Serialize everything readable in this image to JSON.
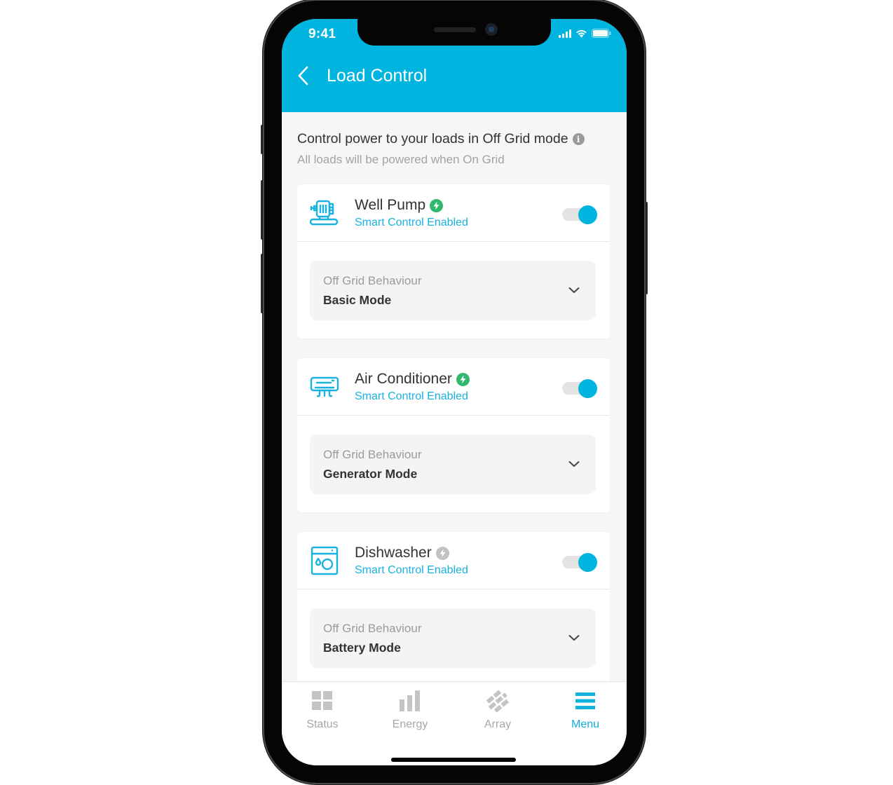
{
  "status_bar": {
    "time": "9:41"
  },
  "header": {
    "title": "Load Control",
    "back_icon": "chevron-left-icon"
  },
  "intro": {
    "title": "Control power to your loads in Off Grid mode",
    "info_icon": "i",
    "subtitle": "All loads will be powered when On Grid"
  },
  "loads": [
    {
      "name": "Well Pump",
      "icon": "well-pump-icon",
      "status": "Smart Control Enabled",
      "bolt_state": "active",
      "bolt_color": "#30b86e",
      "enabled": true,
      "behaviour_label": "Off Grid Behaviour",
      "behaviour_value": "Basic Mode"
    },
    {
      "name": "Air Conditioner",
      "icon": "air-conditioner-icon",
      "status": "Smart Control Enabled",
      "bolt_state": "active",
      "bolt_color": "#30b86e",
      "enabled": true,
      "behaviour_label": "Off Grid Behaviour",
      "behaviour_value": "Generator Mode"
    },
    {
      "name": "Dishwasher",
      "icon": "dishwasher-icon",
      "status": "Smart Control Enabled",
      "bolt_state": "inactive",
      "bolt_color": "#c2c2c2",
      "enabled": true,
      "behaviour_label": "Off Grid Behaviour",
      "behaviour_value": "Battery Mode"
    }
  ],
  "tabbar": {
    "items": [
      {
        "label": "Status",
        "icon": "grid-icon",
        "active": false
      },
      {
        "label": "Energy",
        "icon": "bar-chart-icon",
        "active": false
      },
      {
        "label": "Array",
        "icon": "solar-array-icon",
        "active": false
      },
      {
        "label": "Menu",
        "icon": "menu-icon",
        "active": true
      }
    ]
  },
  "colors": {
    "brand": "#00b4e0",
    "accent_text": "#19b2df",
    "smart_active": "#30b86e",
    "smart_inactive": "#c2c2c2",
    "tab_inactive": "#a7a7a7"
  }
}
